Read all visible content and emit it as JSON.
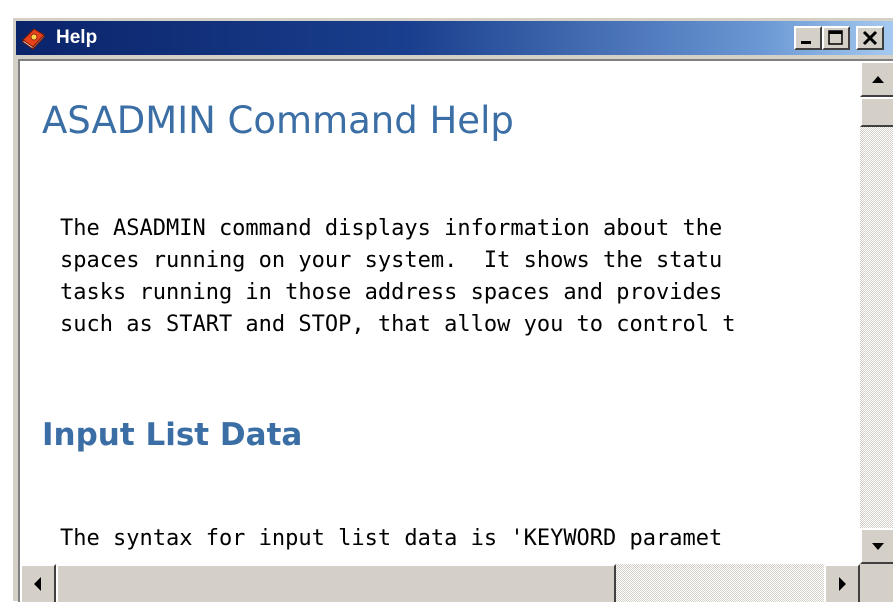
{
  "window": {
    "title": "Help",
    "icon": "help-book-icon",
    "caption_buttons": [
      "minimize-icon",
      "maximize-icon",
      "close-icon"
    ]
  },
  "document": {
    "title": "ASADMIN Command Help",
    "intro_lines": [
      "The ASADMIN command displays information about the",
      "spaces running on your system.  It shows the statu",
      "tasks running in those address spaces and provides",
      "such as START and STOP, that allow you to control t"
    ],
    "section_heading": "Input List Data",
    "syntax_line": "The syntax for input list data is 'KEYWORD paramet"
  },
  "scrollbars": {
    "vertical": {
      "up_icon": "arrow-up-icon",
      "down_icon": "arrow-down-icon"
    },
    "horizontal": {
      "left_icon": "arrow-left-icon",
      "right_icon": "arrow-right-icon"
    }
  },
  "colors": {
    "title_gradient_start": "#0a246a",
    "title_gradient_end": "#a6caf0",
    "heading": "#3a6ea5",
    "chrome": "#d4d0c8"
  }
}
